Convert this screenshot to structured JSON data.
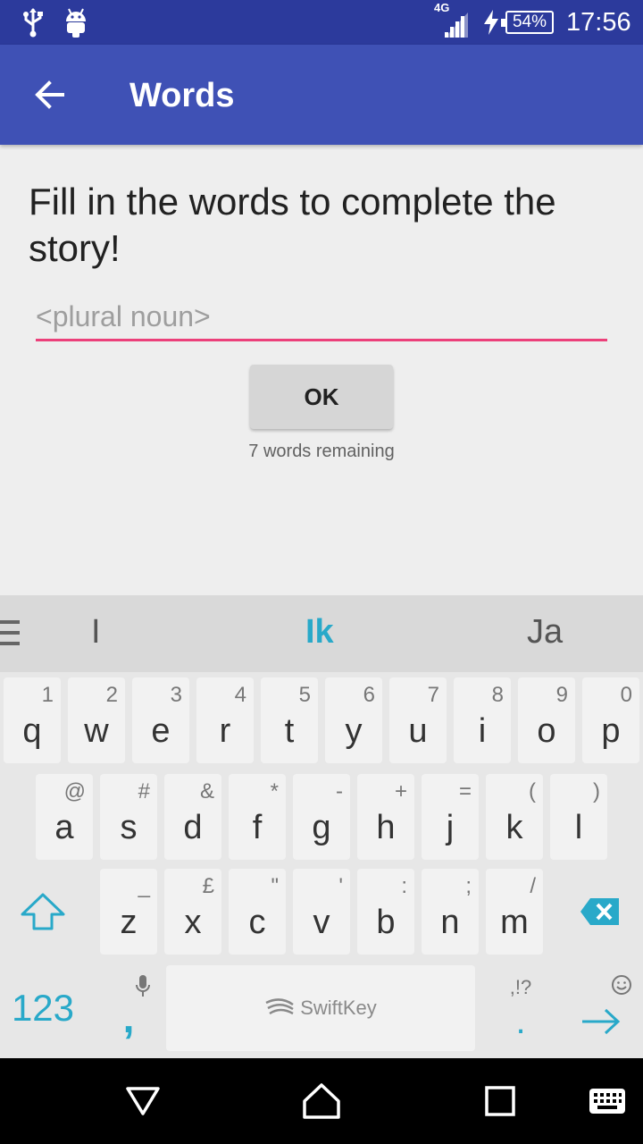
{
  "status_bar": {
    "network": "4G",
    "battery": "54%",
    "time": "17:56",
    "icons": [
      "usb-icon",
      "android-debug-icon",
      "signal-icon",
      "charging-icon",
      "battery-icon"
    ]
  },
  "app_bar": {
    "title": "Words",
    "back_icon": "arrow-back-icon",
    "color": "#3f51b5"
  },
  "main": {
    "prompt": "Fill in the words to complete the story!",
    "input": {
      "value": "",
      "placeholder": "<plural noun>",
      "underline_color": "#ec407a"
    },
    "ok_label": "OK",
    "remaining": "7 words remaining"
  },
  "keyboard": {
    "brand": "SwiftKey",
    "suggestions": [
      "I",
      "Ik",
      "Ja"
    ],
    "accent_color": "#29a9c9",
    "rows": [
      [
        {
          "main": "q",
          "sec": "1"
        },
        {
          "main": "w",
          "sec": "2"
        },
        {
          "main": "e",
          "sec": "3"
        },
        {
          "main": "r",
          "sec": "4"
        },
        {
          "main": "t",
          "sec": "5"
        },
        {
          "main": "y",
          "sec": "6"
        },
        {
          "main": "u",
          "sec": "7"
        },
        {
          "main": "i",
          "sec": "8"
        },
        {
          "main": "o",
          "sec": "9"
        },
        {
          "main": "p",
          "sec": "0"
        }
      ],
      [
        {
          "main": "a",
          "sec": "@"
        },
        {
          "main": "s",
          "sec": "#"
        },
        {
          "main": "d",
          "sec": "&"
        },
        {
          "main": "f",
          "sec": "*"
        },
        {
          "main": "g",
          "sec": "-"
        },
        {
          "main": "h",
          "sec": "+"
        },
        {
          "main": "j",
          "sec": "="
        },
        {
          "main": "k",
          "sec": "("
        },
        {
          "main": "l",
          "sec": ")"
        }
      ],
      [
        {
          "main": "z",
          "sec": "_"
        },
        {
          "main": "x",
          "sec": "£"
        },
        {
          "main": "c",
          "sec": "\""
        },
        {
          "main": "v",
          "sec": "'"
        },
        {
          "main": "b",
          "sec": ":"
        },
        {
          "main": "n",
          "sec": ";"
        },
        {
          "main": "m",
          "sec": "/"
        }
      ]
    ],
    "numbers_label": "123",
    "comma": ",",
    "period_sec": ",!?",
    "period": "."
  },
  "nav_bar": {
    "icons": [
      "back-triangle-icon",
      "home-icon",
      "recents-icon",
      "keyboard-switch-icon"
    ]
  }
}
